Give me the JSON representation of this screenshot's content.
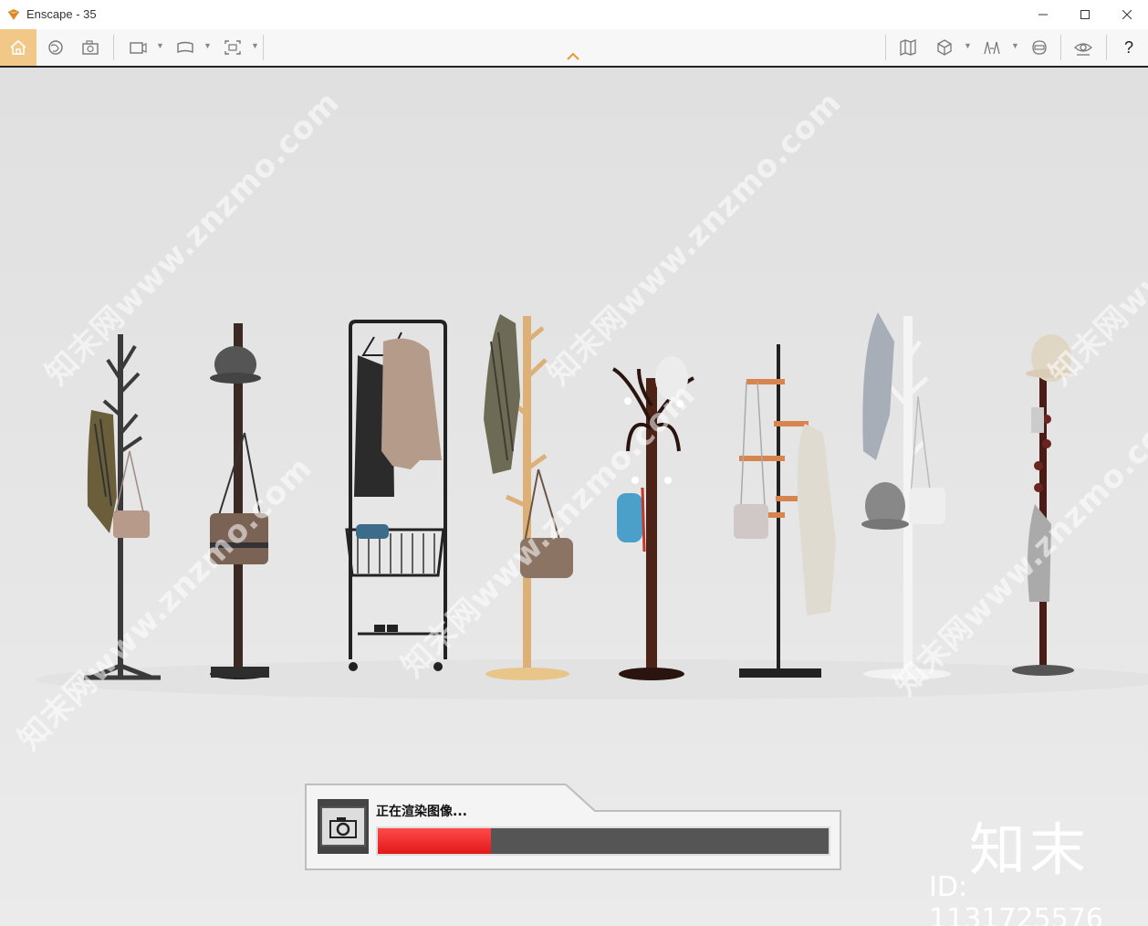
{
  "window": {
    "title": "Enscape - 35"
  },
  "window_controls": {
    "minimize": "—",
    "maximize": "☐",
    "close": "✕"
  },
  "toolbar": {
    "left": [
      "home-icon",
      "asset-library-icon",
      "screenshot-icon",
      "video-path-icon",
      "panorama-icon",
      "batch-render-icon"
    ],
    "right": [
      "map-icon",
      "view-cube-icon",
      "spectacles-icon",
      "vr-headset-icon",
      "visibility-icon"
    ],
    "help": "?"
  },
  "colors": {
    "accent": "#f2c888",
    "progress": "#e82020",
    "collapse_arrow": "#e79a30"
  },
  "viewport": {
    "watermark_text": "知末网www.znzmo.com",
    "brand_logo": "知末",
    "brand_id": "ID: 1131725576"
  },
  "render_status": {
    "text": "正在渲染图像...",
    "icon": "camera-icon",
    "progress": 0.25
  }
}
